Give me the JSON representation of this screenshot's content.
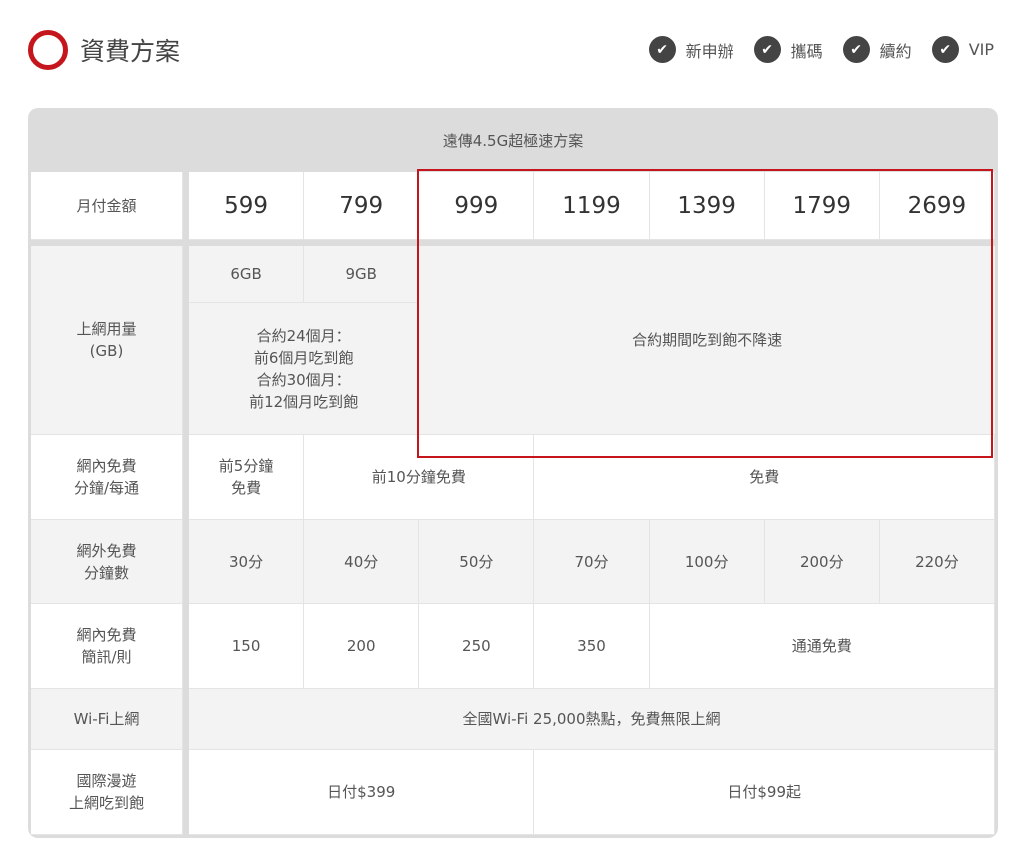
{
  "header": {
    "title": "資費方案",
    "tags": [
      "新申辦",
      "攜碼",
      "續約",
      "VIP"
    ]
  },
  "table": {
    "caption": "遠傳4.5G超極速方案",
    "price_label": "月付金額",
    "prices": [
      "599",
      "799",
      "999",
      "1199",
      "1399",
      "1799",
      "2699"
    ],
    "data_label": "上網用量\n(GB)",
    "data_caps": [
      "6GB",
      "9GB"
    ],
    "data_contract_note": "合約24個月：\n前6個月吃到飽\n合約30個月：\n前12個月吃到飽",
    "data_unlimited": "合約期間吃到飽不降速",
    "onnet_call_label": "網內免費\n分鐘/每通",
    "onnet_call": [
      "前5分鐘\n免費",
      "前10分鐘免費",
      "免費"
    ],
    "offnet_label": "網外免費\n分鐘數",
    "offnet": [
      "30分",
      "40分",
      "50分",
      "70分",
      "100分",
      "200分",
      "220分"
    ],
    "sms_label": "網內免費\n簡訊/則",
    "sms": [
      "150",
      "200",
      "250",
      "350",
      "通通免費"
    ],
    "wifi_label": "Wi-Fi上網",
    "wifi": "全國Wi-Fi 25,000熱點，免費無限上網",
    "roaming_label": "國際漫遊\n上網吃到飽",
    "roaming": [
      "日付$399",
      "日付$99起"
    ]
  },
  "colors": {
    "accent": "#c4161c"
  }
}
